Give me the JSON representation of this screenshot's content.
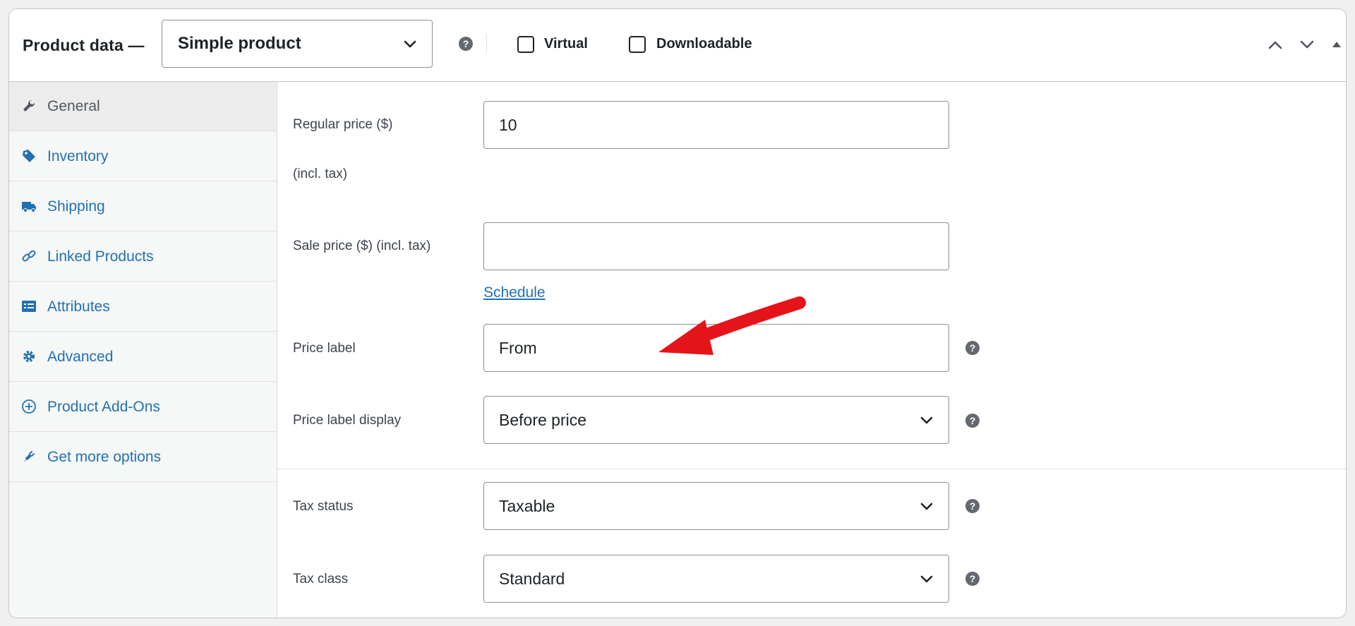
{
  "header": {
    "title": "Product data —",
    "product_type": "Simple product",
    "virtual_label": "Virtual",
    "downloadable_label": "Downloadable",
    "help_glyph": "?"
  },
  "sidebar": {
    "items": [
      {
        "label": "General",
        "icon": "wrench-icon",
        "active": true
      },
      {
        "label": "Inventory",
        "icon": "tag-icon",
        "active": false
      },
      {
        "label": "Shipping",
        "icon": "truck-icon",
        "active": false
      },
      {
        "label": "Linked Products",
        "icon": "link-icon",
        "active": false
      },
      {
        "label": "Attributes",
        "icon": "list-icon",
        "active": false
      },
      {
        "label": "Advanced",
        "icon": "gear-icon",
        "active": false
      },
      {
        "label": "Product Add-Ons",
        "icon": "plus-circle-icon",
        "active": false
      },
      {
        "label": "Get more options",
        "icon": "plugin-icon",
        "active": false
      }
    ]
  },
  "general": {
    "regular_price_label": "Regular price ($)",
    "regular_price_sub": "(incl. tax)",
    "regular_price_value": "10",
    "sale_price_label": "Sale price ($) (incl. tax)",
    "sale_price_value": "",
    "schedule_link": "Schedule",
    "price_label_label": "Price label",
    "price_label_value": "From",
    "price_label_display_label": "Price label display",
    "price_label_display_value": "Before price",
    "tax_status_label": "Tax status",
    "tax_status_value": "Taxable",
    "tax_class_label": "Tax class",
    "tax_class_value": "Standard"
  },
  "colors": {
    "accent": "#2271b1",
    "annotation_arrow": "#e5141b"
  }
}
